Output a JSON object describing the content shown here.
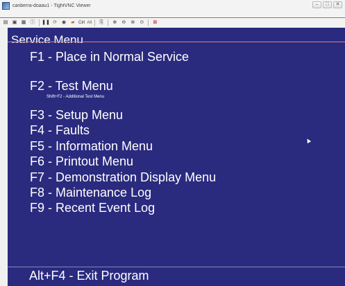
{
  "window": {
    "title": "canberra-doaau1 - TightVNC Viewer"
  },
  "toolbar": {
    "ctrl_label": "Ctrl",
    "alt_label": "Alt"
  },
  "screen": {
    "header": "Service Menu",
    "items": [
      {
        "label": "F1 - Place in Normal Service"
      },
      {
        "label": "F2 - Test Menu",
        "subtext": "Shift+F2 - Additional Test Menu"
      },
      {
        "label": "F3 - Setup Menu"
      },
      {
        "label": "F4 - Faults"
      },
      {
        "label": "F5 - Information Menu"
      },
      {
        "label": "F6 - Printout Menu"
      },
      {
        "label": "F7 - Demonstration Display Menu"
      },
      {
        "label": "F8 - Maintenance Log"
      },
      {
        "label": "F9 - Recent Event Log"
      }
    ],
    "footer": "Alt+F4 - Exit Program",
    "background_color": "#2a2a7f"
  }
}
